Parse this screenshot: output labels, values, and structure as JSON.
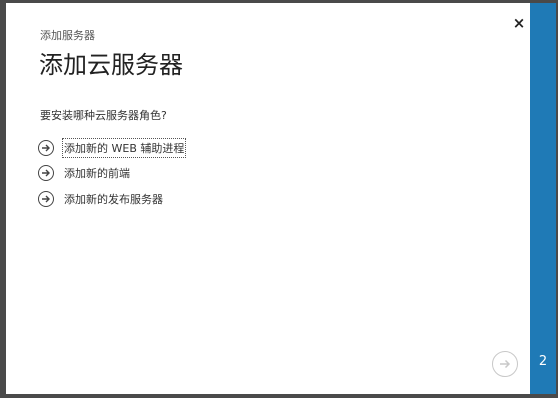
{
  "dialog": {
    "breadcrumb": "添加服务器",
    "title": "添加云服务器",
    "question": "要安装哪种云服务器角色?",
    "close_label": "×",
    "options": [
      {
        "label": "添加新的 WEB 辅助进程",
        "icon": "arrow-right-circle-icon",
        "focused": true
      },
      {
        "label": "添加新的前端",
        "icon": "arrow-right-circle-icon",
        "focused": false
      },
      {
        "label": "添加新的发布服务器",
        "icon": "arrow-right-circle-icon",
        "focused": false
      }
    ],
    "next_icon": "arrow-right-circle-icon",
    "step_number": "2"
  },
  "colors": {
    "accent": "#1f7ab6",
    "background": "#ffffff",
    "frame": "#4a4a4a"
  }
}
